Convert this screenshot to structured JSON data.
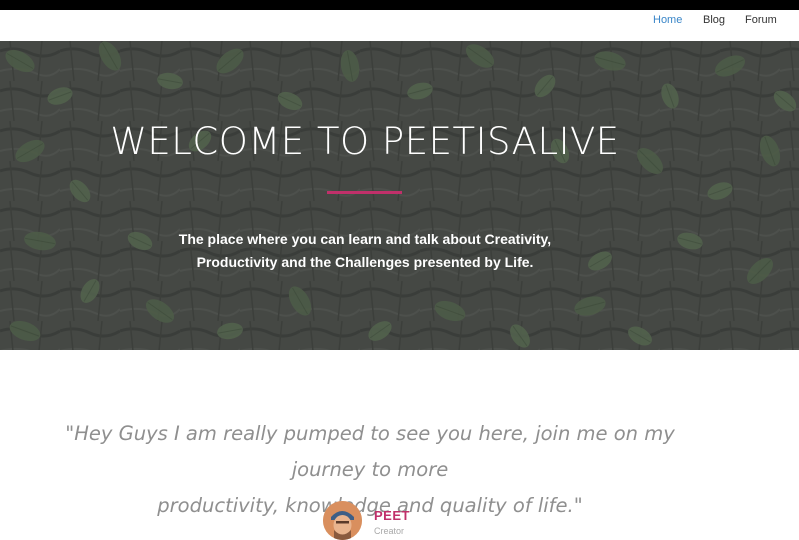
{
  "nav": {
    "items": [
      {
        "label": "Home",
        "active": true
      },
      {
        "label": "Blog",
        "active": false
      },
      {
        "label": "Forum",
        "active": false
      }
    ]
  },
  "hero": {
    "title": "WELCOME TO PEETISALIVE",
    "subtitle_line1": "The place where you can learn and talk about Creativity,",
    "subtitle_line2": "Productivity and the Challenges presented by Life.",
    "accent_color": "#c0306a"
  },
  "testimonial": {
    "quote_line1": "\"Hey Guys I am really pumped to see you here, join me on my journey to more",
    "quote_line2": "productivity, knowledge and quality of life.\"",
    "author_name": "PEET",
    "author_role": "Creator",
    "avatar_icon": "person-avatar-icon"
  },
  "colors": {
    "link_active": "#3a86c8",
    "accent": "#c0306a",
    "quote_text": "#8f8f8f"
  }
}
